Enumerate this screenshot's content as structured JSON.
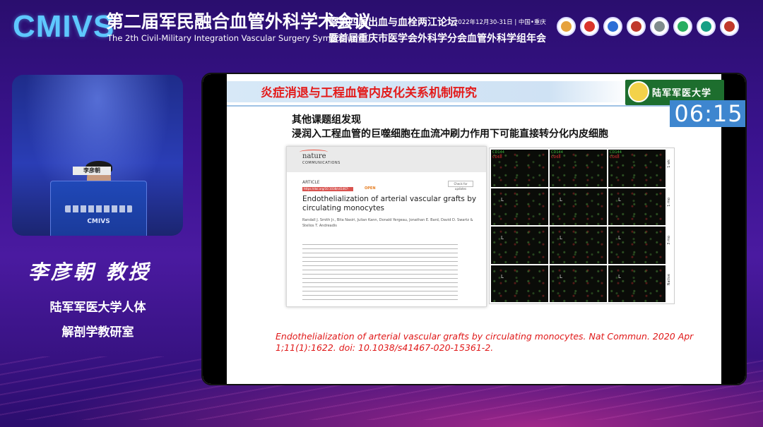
{
  "header": {
    "brand": "CMIVS",
    "title_cn": "第二届军民融合血管外科学术会议",
    "title_en": "The 2th Civil-Military Integration Vascular Surgery Symposium",
    "sub1": "暨第四届出血与血栓两江论坛",
    "date": "2022年12月30-31日 | 中国•重庆",
    "sub2": "暨首届重庆市医学会外科学分会血管外科学组年会",
    "logos": [
      {
        "name": "logo-1",
        "color": "#e6a23c"
      },
      {
        "name": "logo-2",
        "color": "#d9342b"
      },
      {
        "name": "logo-3",
        "color": "#2d6fd6"
      },
      {
        "name": "logo-4",
        "color": "#c0392b"
      },
      {
        "name": "logo-5",
        "color": "#7f8c8d"
      },
      {
        "name": "logo-6",
        "color": "#27ae60"
      },
      {
        "name": "logo-7",
        "color": "#16a085"
      },
      {
        "name": "logo-8",
        "color": "#c0392b"
      }
    ]
  },
  "camera": {
    "nameplate": "李彦朝",
    "podium_brand": "CMIVS"
  },
  "speaker": {
    "name": "李彦朝  教授",
    "aff_line1": "陆军军医大学人体",
    "aff_line2": "解剖学教研室"
  },
  "slide": {
    "title": "炎症消退与工程血管内皮化关系机制研究",
    "university": "陆军军医大学",
    "timer": "06:15",
    "heading1": "其他课题组发现",
    "heading2": "浸润入工程血管的巨噬细胞在血流冲刷力作用下可能直接转分化内皮细胞",
    "article": {
      "journal_line1": "nature",
      "journal_line2": "COMMUNICATIONS",
      "type": "ARTICLE",
      "doi": "https://doi.org/10.1038/s41467-020-15361-2",
      "open": "OPEN",
      "check": "Check for updates",
      "title": "Endothelialization of arterial vascular grafts by circulating monocytes",
      "authors": "Randall J. Smith Jr., Bita Nasiri, Julian Kann, Donald Yergeau, Jonathan E. Bard, David D. Swartz & Stelios T. Andreadis"
    },
    "figure": {
      "col_labels_green": [
        "CD144",
        "CD144",
        "CD144"
      ],
      "col_labels_red": [
        "CD68",
        "CD68",
        "CD68"
      ],
      "row_labels": [
        "1 wk",
        "1 mo",
        "3 mo",
        "Native"
      ],
      "cell_marker": "L"
    },
    "citation": "Endothelialization of arterial vascular grafts by circulating monocytes. Nat Commun. 2020 Apr 1;11(1):1622. doi: 10.1038/s41467-020-15361-2."
  }
}
